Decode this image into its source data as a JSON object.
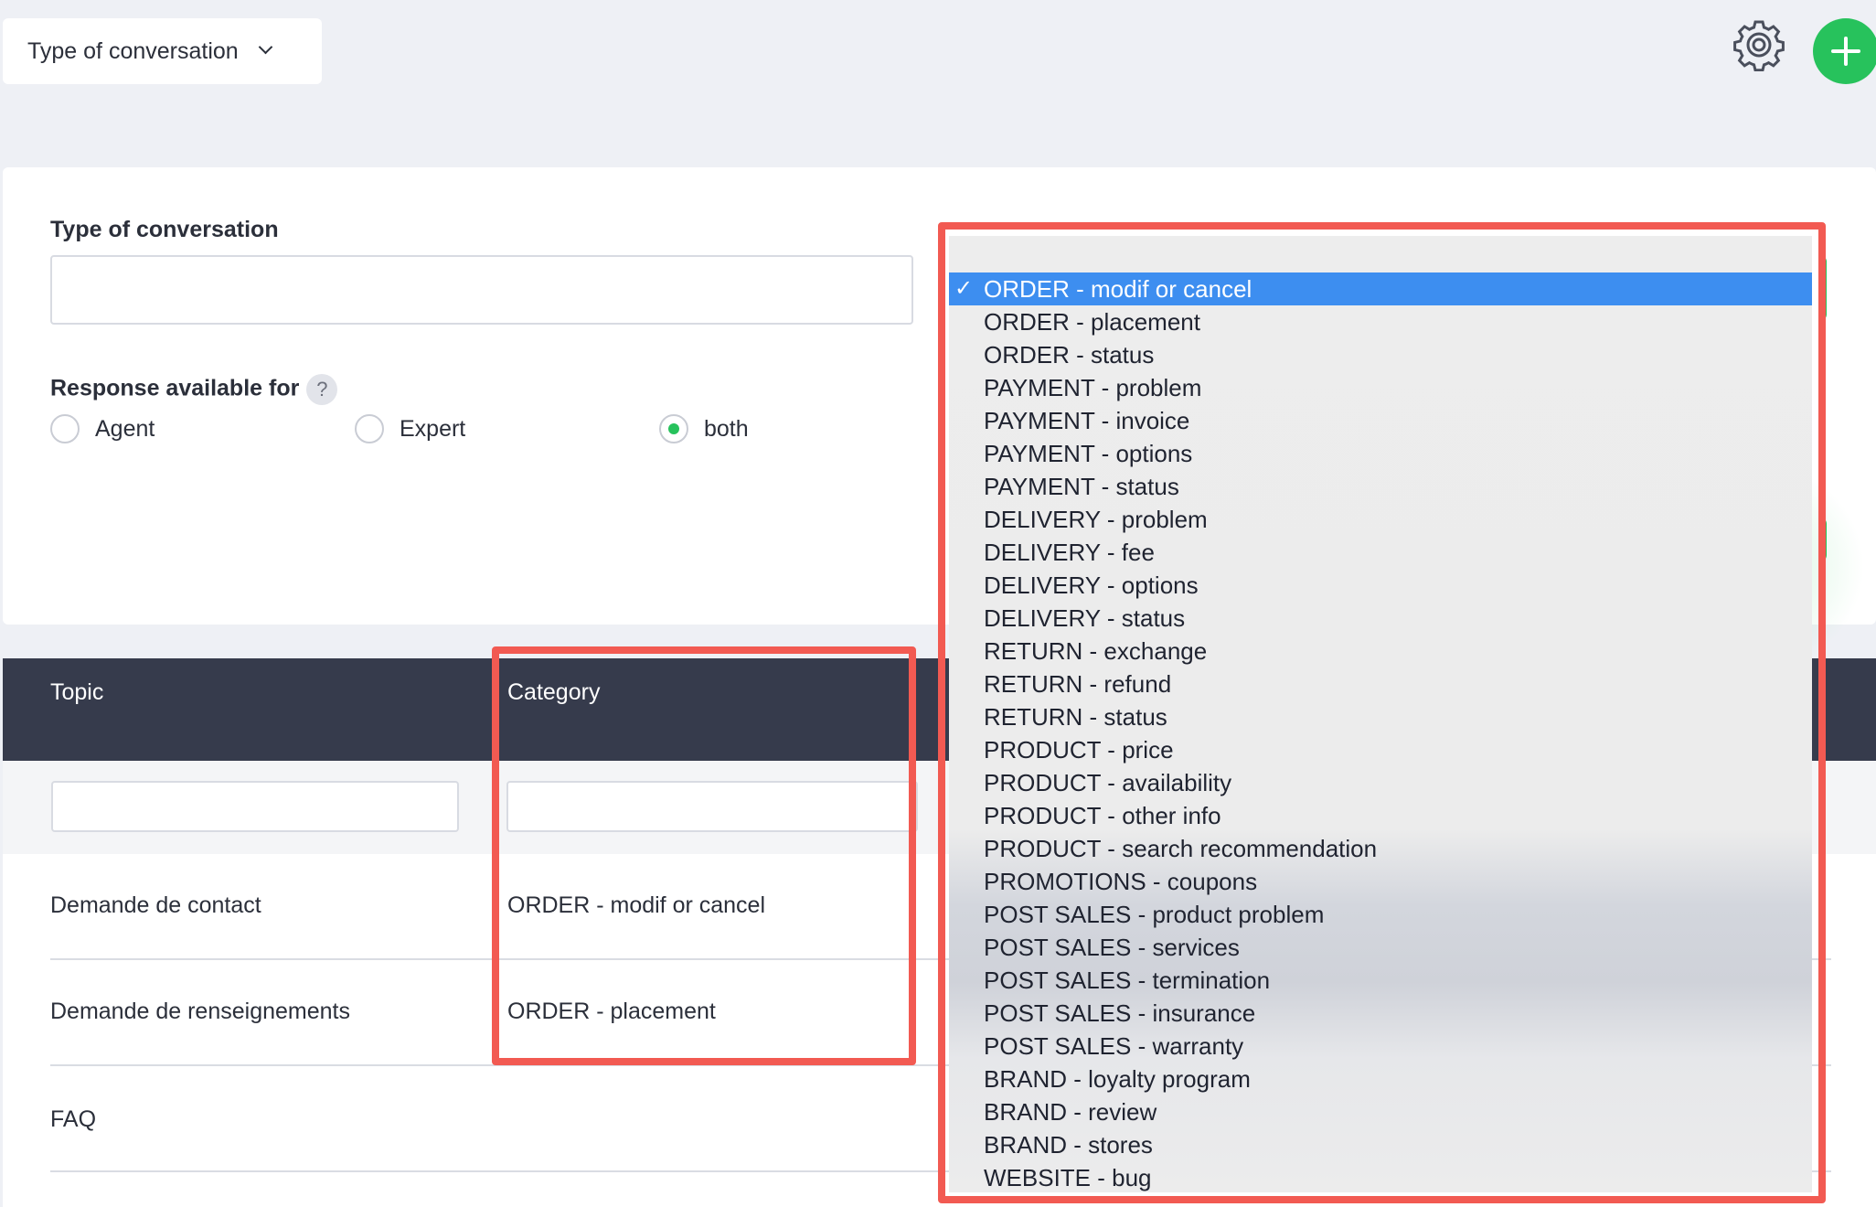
{
  "header": {
    "filter_label": "Type of conversation",
    "settings_icon": "gear-icon",
    "add_icon": "plus-icon",
    "accent_color": "#27c25c"
  },
  "form": {
    "type_label": "Type of conversation",
    "type_value": "",
    "response_label": "Response available for",
    "help_text": "?",
    "radio_options": [
      {
        "label": "Agent",
        "checked": false
      },
      {
        "label": "Expert",
        "checked": false
      },
      {
        "label": "both",
        "checked": true
      }
    ]
  },
  "table": {
    "columns": [
      "Topic",
      "Category"
    ],
    "filters": [
      "",
      ""
    ],
    "rows": [
      {
        "topic": "Demande de contact",
        "category": "ORDER - modif or cancel"
      },
      {
        "topic": "Demande de renseignements",
        "category": "ORDER - placement"
      },
      {
        "topic": "FAQ",
        "category": ""
      }
    ],
    "header_color": "#363b4c"
  },
  "dropdown": {
    "check_mark": "✓",
    "selected_index": 0,
    "selected_color": "#3d8ef0",
    "options": [
      "ORDER - modif or cancel",
      "ORDER - placement",
      "ORDER - status",
      "PAYMENT - problem",
      "PAYMENT - invoice",
      "PAYMENT - options",
      "PAYMENT - status",
      "DELIVERY - problem",
      "DELIVERY - fee",
      "DELIVERY - options",
      "DELIVERY - status",
      "RETURN - exchange",
      "RETURN - refund",
      "RETURN - status",
      "PRODUCT - price",
      "PRODUCT - availability",
      "PRODUCT - other info",
      "PRODUCT - search recommendation",
      "PROMOTIONS - coupons",
      "POST SALES - product problem",
      "POST SALES - services",
      "POST SALES - termination",
      "POST SALES - insurance",
      "POST SALES - warranty",
      "BRAND - loyalty program",
      "BRAND - review",
      "BRAND - stores",
      "WEBSITE - bug"
    ]
  },
  "annotation_color": "#f25a52"
}
